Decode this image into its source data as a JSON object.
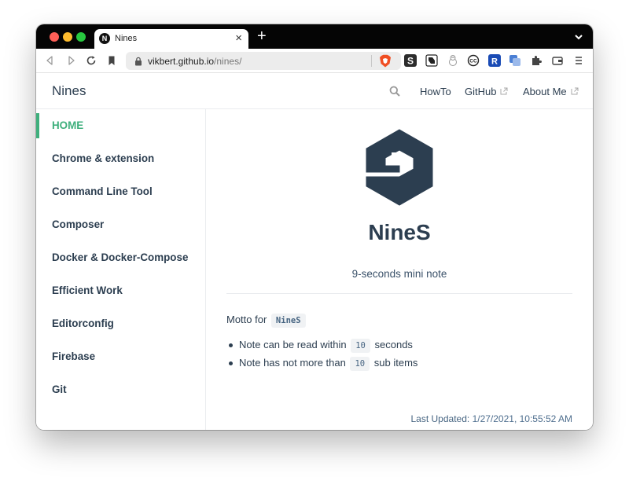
{
  "browser": {
    "tab_title": "Nines",
    "tab_favicon_letter": "N",
    "url_host": "vikbert.github.io",
    "url_path": "/nines/",
    "new_tab_glyph": "+",
    "close_glyph": "×",
    "extensions": [
      "s-extension-icon",
      "notion-icon",
      "snowman-icon",
      "cc-icon",
      "r-extension-icon",
      "translate-icon",
      "puzzle-icon",
      "wallet-icon",
      "menu-icon"
    ]
  },
  "site": {
    "title": "Nines",
    "nav": {
      "howto": "HowTo",
      "github": "GitHub",
      "about": "About Me"
    }
  },
  "sidebar": {
    "items": [
      {
        "label": "HOME",
        "active": true
      },
      {
        "label": "Chrome & extension"
      },
      {
        "label": "Command Line Tool"
      },
      {
        "label": "Composer"
      },
      {
        "label": "Docker & Docker-Compose"
      },
      {
        "label": "Efficient Work"
      },
      {
        "label": "Editorconfig"
      },
      {
        "label": "Firebase"
      },
      {
        "label": "Git"
      }
    ]
  },
  "hero": {
    "title": "NineS",
    "description": "9-seconds mini note"
  },
  "content": {
    "motto_prefix": "Motto for",
    "motto_code": "NineS",
    "bullets": [
      {
        "before": "Note can be read within",
        "code": "10",
        "after": "seconds"
      },
      {
        "before": "Note has not more than",
        "code": "10",
        "after": "sub items"
      }
    ],
    "last_updated_label": "Last Updated:",
    "last_updated_value": "1/27/2021, 10:55:52 AM"
  },
  "colors": {
    "accent": "#3eaf7c",
    "text": "#2c3e50",
    "code_text": "#476582",
    "logo": "#2c3e50"
  }
}
